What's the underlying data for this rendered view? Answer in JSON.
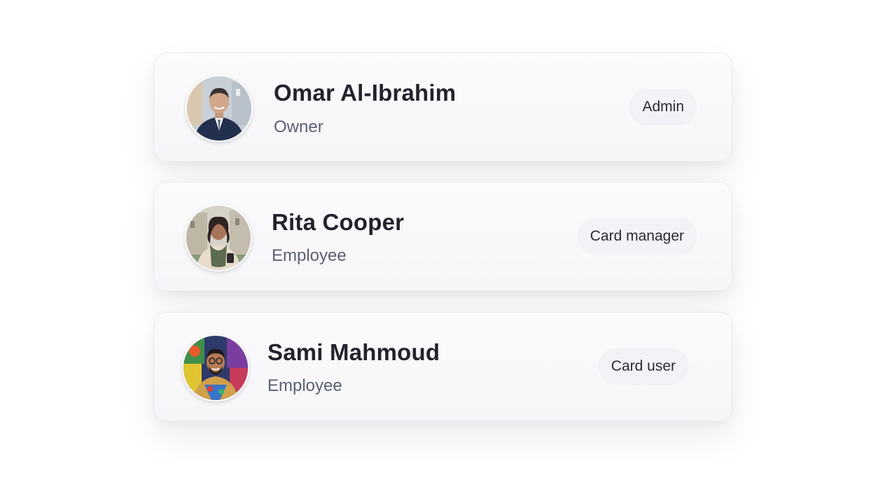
{
  "members": [
    {
      "name": "Omar Al-Ibrahim",
      "role": "Owner",
      "badge": "Admin",
      "avatar_icon": "person-suit-avatar"
    },
    {
      "name": "Rita Cooper",
      "role": "Employee",
      "badge": "Card manager",
      "avatar_icon": "person-scarf-avatar"
    },
    {
      "name": "Sami Mahmoud",
      "role": "Employee",
      "badge": "Card user",
      "avatar_icon": "person-graffiti-avatar"
    }
  ],
  "colors": {
    "card_bg": "#f8f8fb",
    "name_text": "#23232e",
    "role_text": "#5b6074",
    "badge_bg": "#f3f3f7"
  }
}
